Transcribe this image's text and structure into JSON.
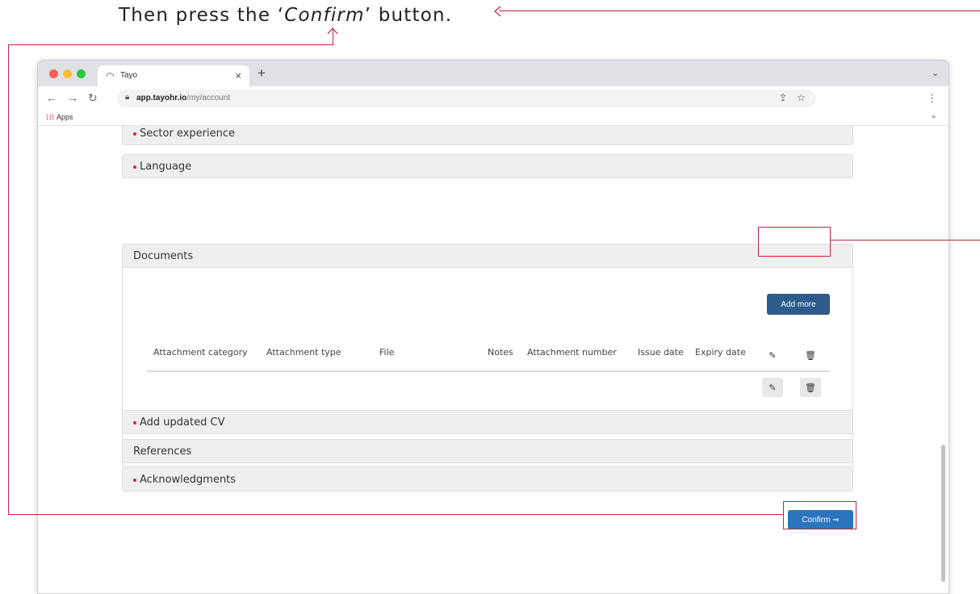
{
  "instruction": {
    "prefix": "Then press the ‘",
    "emphasis": "Confirm",
    "suffix": "’ button."
  },
  "browser": {
    "tab_title": "Tayo",
    "tab_close": "×",
    "new_tab": "+",
    "url_domain": "app.tayohr.io",
    "url_path": "/my/account",
    "bookmark_apps": "Apps",
    "bookmark_more": "»"
  },
  "sections": {
    "sector": "Sector experience",
    "language": "Language",
    "documents": "Documents",
    "cv": "Add updated CV",
    "references": "References",
    "acknowledgments": "Acknowledgments"
  },
  "documents": {
    "add_more": "Add more",
    "columns": [
      "Attachment category",
      "Attachment type",
      "File",
      "Notes",
      "Attachment number",
      "Issue date",
      "Expiry date"
    ]
  },
  "confirm_label": "Confirm ➞",
  "colors": {
    "primary_dark": "#2e5b8a",
    "primary": "#2b74be",
    "annotation": "#c8243d",
    "required_dot": "#d0283d"
  },
  "icons": [
    "edit-icon",
    "trash-icon",
    "lock-icon",
    "share-icon",
    "star-icon",
    "apps-grid-icon"
  ]
}
